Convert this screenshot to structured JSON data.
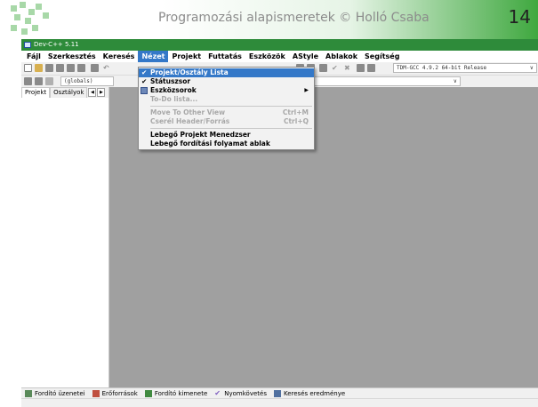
{
  "slide": {
    "title": "Programozási alapismeretek © Holló Csaba",
    "page_number": "14"
  },
  "window": {
    "title": "Dev-C++ 5.11"
  },
  "menubar": {
    "items": [
      "Fájl",
      "Szerkesztés",
      "Keresés",
      "Nézet",
      "Projekt",
      "Futtatás",
      "Eszközök",
      "AStyle",
      "Ablakok",
      "Segítség"
    ],
    "active": "Nézet"
  },
  "toolbar": {
    "compiler_select": "TDM-GCC 4.9.2 64-bit Release",
    "scope_select": "(globals)"
  },
  "view_menu": {
    "items": [
      {
        "label": "Projekt/Osztály Lista",
        "checked": true,
        "highlighted": true
      },
      {
        "label": "Státuszsor",
        "checked": true
      },
      {
        "label": "Eszközsorok",
        "submenu": true,
        "icon": "toolbars-icon"
      },
      {
        "label": "To-Do lista...",
        "disabled": true
      },
      {
        "label": "Move To Other View",
        "shortcut": "Ctrl+M",
        "disabled": true
      },
      {
        "label": "Cserél Header/Forrás",
        "shortcut": "Ctrl+Q",
        "disabled": true
      },
      {
        "label": "Lebegő Projekt Menedzser"
      },
      {
        "label": "Lebegő fordítási folyamat ablak"
      }
    ]
  },
  "left_panel": {
    "tabs": [
      "Projekt",
      "Osztályok"
    ]
  },
  "bottom_tabs": [
    "Fordító üzenetei",
    "Erőforrások",
    "Fordító kimenete",
    "Nyomkövetés",
    "Keresés eredménye"
  ],
  "colors": {
    "titlebar": "#2e8b3a",
    "menu_highlight": "#3478c8",
    "editor_background": "#a0a0a0"
  }
}
